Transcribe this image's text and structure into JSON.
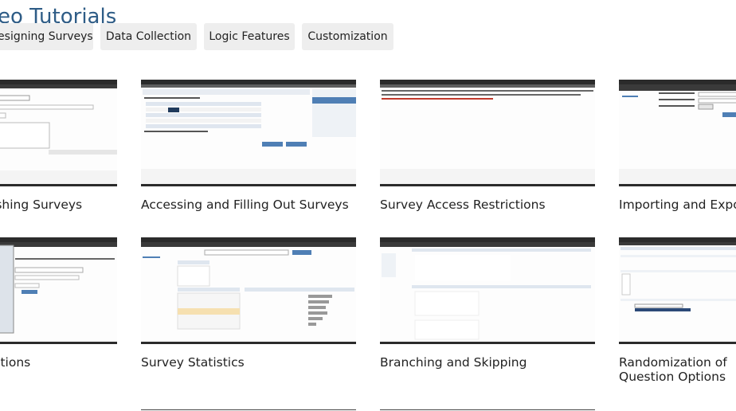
{
  "header": {
    "title": "Video Tutorials"
  },
  "tabs": [
    {
      "label": "Designing Surveys"
    },
    {
      "label": "Data Collection"
    },
    {
      "label": "Logic Features"
    },
    {
      "label": "Customization"
    }
  ],
  "videos": [
    {
      "title": "Publishing Surveys"
    },
    {
      "title": "Accessing and Filling Out Surveys"
    },
    {
      "title": "Survey Access Restrictions"
    },
    {
      "title": "Importing and Exporting"
    },
    {
      "title": "Invitations"
    },
    {
      "title": "Survey Statistics"
    },
    {
      "title": "Branching and Skipping"
    },
    {
      "title": "Randomization of Question Options"
    }
  ],
  "colors": {
    "title": "#2e5c86",
    "tab_bg": "#eeeeee",
    "thumb_frame": "#2b2b2b"
  }
}
